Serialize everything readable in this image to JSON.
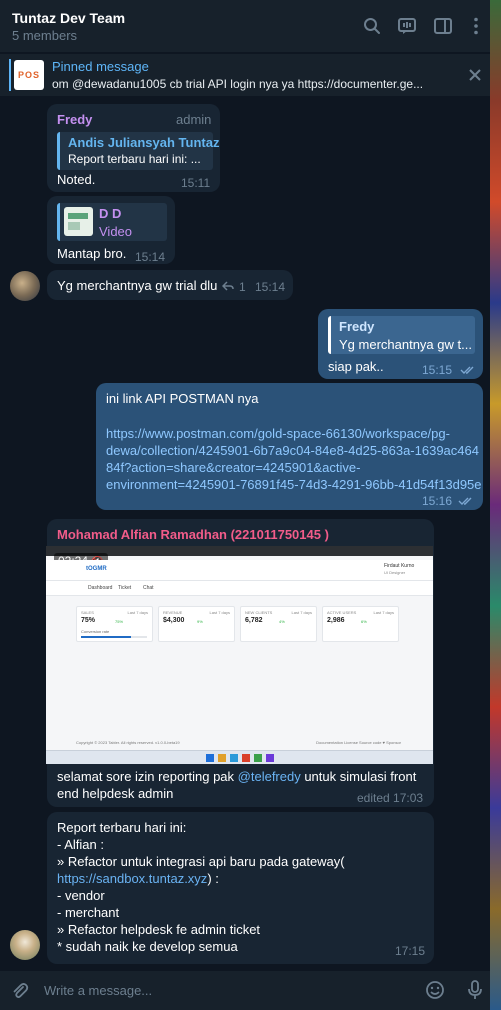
{
  "header": {
    "title": "Tuntaz Dev Team",
    "subtitle": "5 members"
  },
  "pinned": {
    "title": "Pinned message",
    "text": "om @dewadanu1005 cb trial API login nya ya  https://documenter.ge...",
    "thumb_text": "POS"
  },
  "messages": {
    "m1": {
      "sender": "Fredy",
      "role": "admin",
      "reply_author": "Andis Juliansyah Tuntaz",
      "reply_text": "Report terbaru hari ini: ...",
      "text": "Noted.",
      "time": "15:11"
    },
    "m2": {
      "reply_author": "D D",
      "reply_text": "Video",
      "text": "Mantap bro.",
      "time": "15:14"
    },
    "m3": {
      "text": "Yg merchantnya gw trial dlu",
      "reply_count": "1",
      "time": "15:14"
    },
    "m4": {
      "reply_author": "Fredy",
      "reply_text": "Yg merchantnya gw t...",
      "text": "siap pak..",
      "time": "15:15"
    },
    "m5": {
      "line1": "ini link API POSTMAN nya",
      "link1": "https://www.postman.com/gold-space-66130/workspace/pg-",
      "link2": "dewa/collection/4245901-6b7a9c04-84e8-4d25-863a-1639ac464",
      "link3": "84f?action=share&creator=4245901&active-",
      "link4": "environment=4245901-76891f45-74d3-4291-96bb-41d54f13d95e",
      "time": "15:16"
    },
    "m6": {
      "sender": "Mohamad Alfian Ramadhan (221011750145 )",
      "video_time": "02:24",
      "text1_pre": "selamat sore izin reporting pak ",
      "mention": "@telefredy",
      "text1_post": "  untuk simulasi front",
      "text2": "end helpdesk admin",
      "time": "edited 17:03"
    },
    "m7": {
      "l1": "Report terbaru hari ini:",
      "l2": "- Alfian :",
      "l3": "» Refactor untuk integrasi api baru pada gateway(",
      "l4_link": "https://sandbox.tuntaz.xyz",
      "l4_post": ") :",
      "l5": "- vendor",
      "l6": "- merchant",
      "l7": "» Refactor helpdesk fe admin ticket",
      "l8": "* sudah naik ke develop semua",
      "time": "17:15"
    }
  },
  "screenshot": {
    "brand": "tOGMR",
    "nav_dashboard": "Dashboard",
    "nav_ticket": "Ticket",
    "nav_chat": "Chat",
    "user_name": "Firdaut Kurno",
    "user_role": "UI Designer",
    "cards": [
      {
        "label": "SALES",
        "period": "Last 7 days",
        "value": "75%",
        "sub": "Conversion rate",
        "pct": "75%"
      },
      {
        "label": "REVENUE",
        "period": "Last 7 days",
        "value": "$4,300",
        "sub": "",
        "pct": "9%"
      },
      {
        "label": "NEW CLIENTS",
        "period": "Last 7 days",
        "value": "6,782",
        "sub": "",
        "pct": "4%"
      },
      {
        "label": "ACTIVE USERS",
        "period": "Last 7 days",
        "value": "2,986",
        "sub": "",
        "pct": "6%"
      }
    ],
    "footer_left": "Copyright © 2023 Tabler. All rights reserved.",
    "footer_version": "v1.0.0-beta19",
    "footer_links": "Documentation   License   Source code   ♥ Sponsor"
  },
  "composer": {
    "placeholder": "Write a message..."
  },
  "colors": {
    "accent": "#5eb5f7",
    "outgoing_bubble": "#2b5278",
    "incoming_bubble": "#182533",
    "fredy_name": "#c490f0",
    "alfian_name": "#f25c8a"
  }
}
